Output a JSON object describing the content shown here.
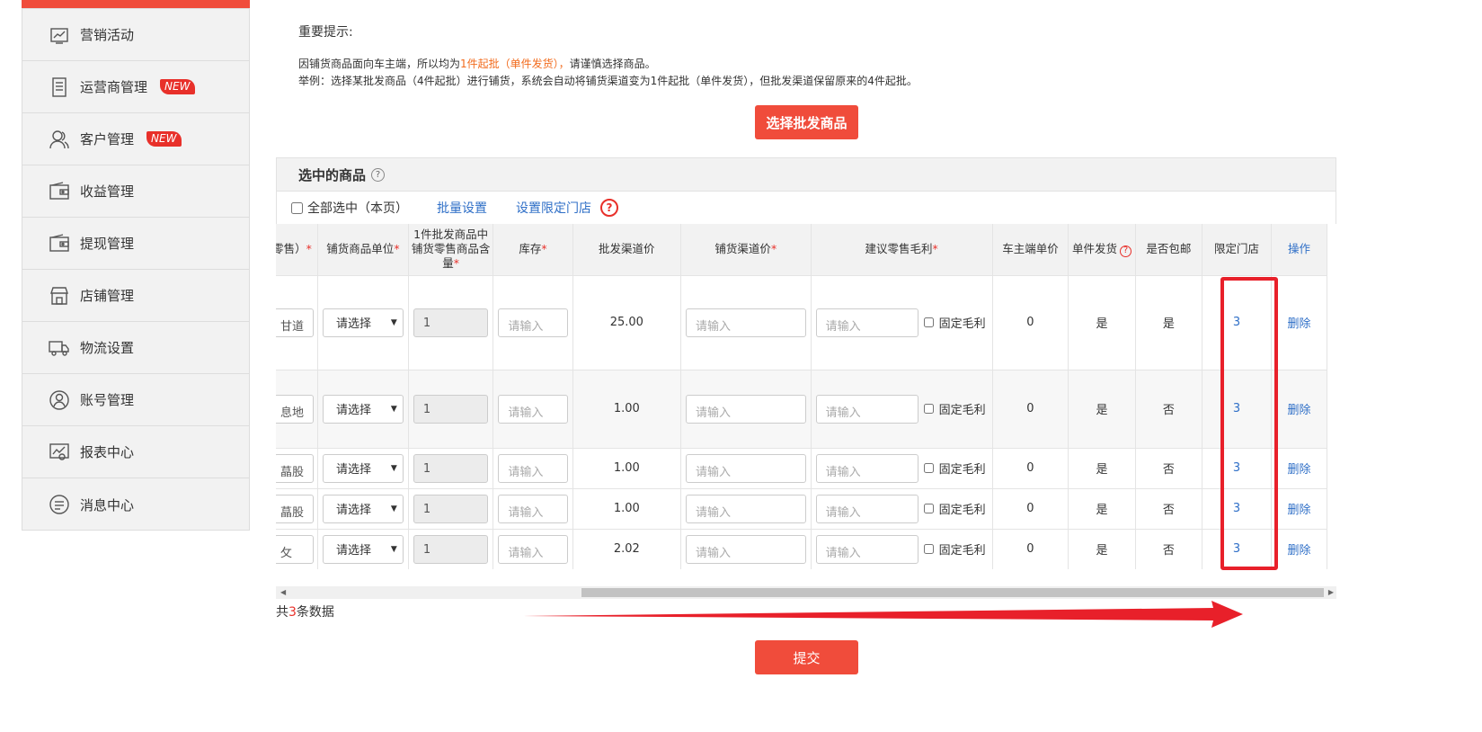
{
  "sidebar": {
    "items": [
      {
        "label": "营销活动",
        "icon": "chart-board-icon",
        "badge": ""
      },
      {
        "label": "运营商管理",
        "icon": "document-list-icon",
        "badge": "NEW"
      },
      {
        "label": "客户管理",
        "icon": "users-icon",
        "badge": "NEW"
      },
      {
        "label": "收益管理",
        "icon": "wallet-icon",
        "badge": ""
      },
      {
        "label": "提现管理",
        "icon": "wallet-icon",
        "badge": ""
      },
      {
        "label": "店铺管理",
        "icon": "store-icon",
        "badge": ""
      },
      {
        "label": "物流设置",
        "icon": "truck-icon",
        "badge": ""
      },
      {
        "label": "账号管理",
        "icon": "user-circle-icon",
        "badge": ""
      },
      {
        "label": "报表中心",
        "icon": "report-icon",
        "badge": ""
      },
      {
        "label": "消息中心",
        "icon": "message-icon",
        "badge": ""
      }
    ]
  },
  "tips": {
    "title": "重要提示:",
    "line1_a": "因铺货商品面向车主端，所以均为",
    "line1_highlight": "1件起批（单件发货），",
    "line1_b": "请谨慎选择商品。",
    "line2": "举例：选择某批发商品（4件起批）进行铺货，系统会自动将铺货渠道变为1件起批（单件发货），但批发渠道保留原来的4件起批。"
  },
  "select_button": "选择批发商品",
  "panel": {
    "title": "选中的商品",
    "help": "?",
    "select_all": "全部选中（本页）",
    "batch_set": "批量设置",
    "set_store": "设置限定门店",
    "red_help": "?"
  },
  "table": {
    "headers": {
      "retail": "零售）",
      "unit": "铺货商品单位",
      "qty_line1": "1件批发商品中",
      "qty_line2": "铺货零售商品含",
      "qty_line3": "量",
      "stock": "库存",
      "wholesale": "批发渠道价",
      "channel": "铺货渠道价",
      "margin": "建议零售毛利",
      "owner_price": "车主端单价",
      "single": "单件发货",
      "shipping": "是否包邮",
      "store": "限定门店",
      "action": "操作"
    },
    "required_mark": "*",
    "rows": [
      {
        "name": "甘道",
        "unit": "请选择",
        "qty": "1",
        "stock_ph": "请输入",
        "wholesale": "25.00",
        "channel_ph": "请输入",
        "margin_ph": "请输入",
        "fix": "固定毛利",
        "owner_price": "0",
        "single": "是",
        "shipping": "是",
        "store": "3",
        "action": "删除"
      },
      {
        "name": "息地",
        "unit": "请选择",
        "qty": "1",
        "stock_ph": "请输入",
        "wholesale": "1.00",
        "channel_ph": "请输入",
        "margin_ph": "请输入",
        "fix": "固定毛利",
        "owner_price": "0",
        "single": "是",
        "shipping": "否",
        "store": "3",
        "action": "删除"
      },
      {
        "name": "蕌股",
        "unit": "请选择",
        "qty": "1",
        "stock_ph": "请输入",
        "wholesale": "1.00",
        "channel_ph": "请输入",
        "margin_ph": "请输入",
        "fix": "固定毛利",
        "owner_price": "0",
        "single": "是",
        "shipping": "否",
        "store": "3",
        "action": "删除"
      },
      {
        "name": "蕌股",
        "unit": "请选择",
        "qty": "1",
        "stock_ph": "请输入",
        "wholesale": "1.00",
        "channel_ph": "请输入",
        "margin_ph": "请输入",
        "fix": "固定毛利",
        "owner_price": "0",
        "single": "是",
        "shipping": "否",
        "store": "3",
        "action": "删除"
      },
      {
        "name": "攵",
        "unit": "请选择",
        "qty": "1",
        "stock_ph": "请输入",
        "wholesale": "2.02",
        "channel_ph": "请输入",
        "margin_ph": "请输入",
        "fix": "固定毛利",
        "owner_price": "0",
        "single": "是",
        "shipping": "否",
        "store": "3",
        "action": "删除"
      }
    ]
  },
  "footer": {
    "count_prefix": "共",
    "count": "3",
    "count_suffix": "条数据",
    "submit": "提交"
  },
  "colors": {
    "accent": "#f04c3b",
    "link": "#2f6fc7",
    "annotation": "#e8202a"
  }
}
